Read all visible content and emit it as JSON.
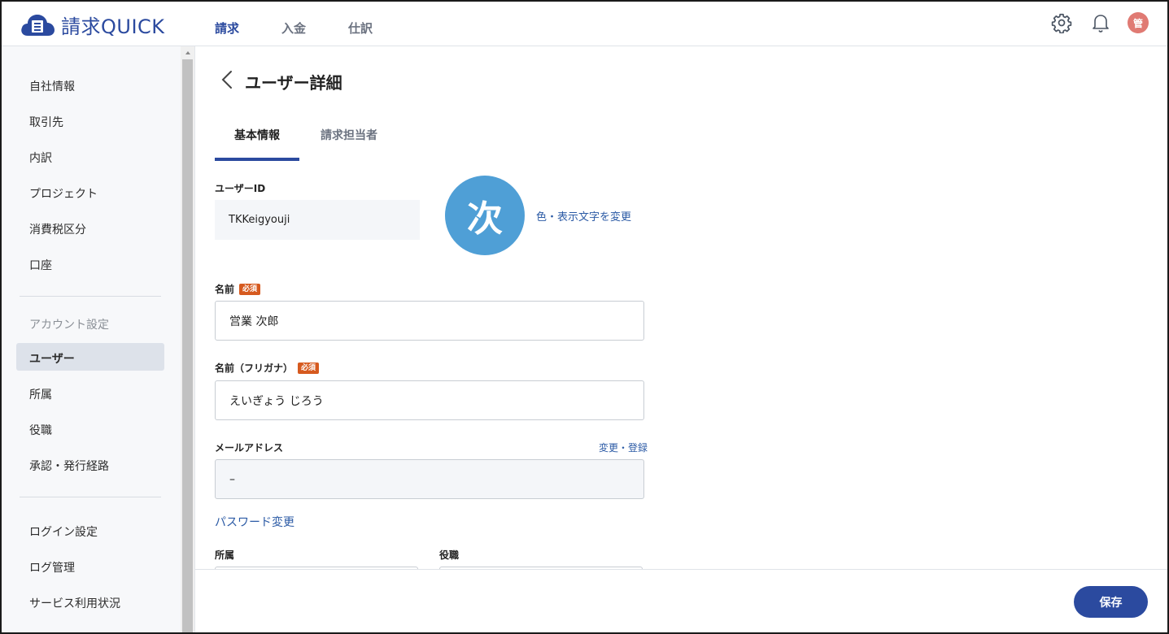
{
  "app": {
    "logo_text": "請求QUICK"
  },
  "topnav": [
    "請求",
    "入金",
    "仕訳"
  ],
  "header": {
    "avatar_char": "管"
  },
  "sidebar": {
    "group1": [
      "自社情報",
      "取引先",
      "内訳",
      "プロジェクト",
      "消費税区分",
      "口座"
    ],
    "section_label": "アカウント設定",
    "group2": [
      "ユーザー",
      "所属",
      "役職",
      "承認・発行経路"
    ],
    "group3": [
      "ログイン設定",
      "ログ管理",
      "サービス利用状況"
    ],
    "active": "ユーザー"
  },
  "page": {
    "title": "ユーザー詳細"
  },
  "tabs": [
    "基本情報",
    "請求担当者"
  ],
  "form": {
    "user_id_label": "ユーザーID",
    "user_id_value": "TKKeigyouji",
    "avatar_char": "次",
    "change_avatar_link": "色・表示文字を変更",
    "required_badge": "必須",
    "name_label": "名前",
    "name_value": "営業 次郎",
    "kana_label": "名前（フリガナ）",
    "kana_value": "えいぎょう じろう",
    "email_label": "メールアドレス",
    "email_link": "変更・登録",
    "email_value": "–",
    "password_link": "パスワード変更",
    "dept_label": "所属",
    "role_label": "役職"
  },
  "footer": {
    "save_label": "保存"
  },
  "colors": {
    "brand": "#2b4a9f",
    "required": "#d65a1f",
    "avatar": "#4f9fd6"
  }
}
